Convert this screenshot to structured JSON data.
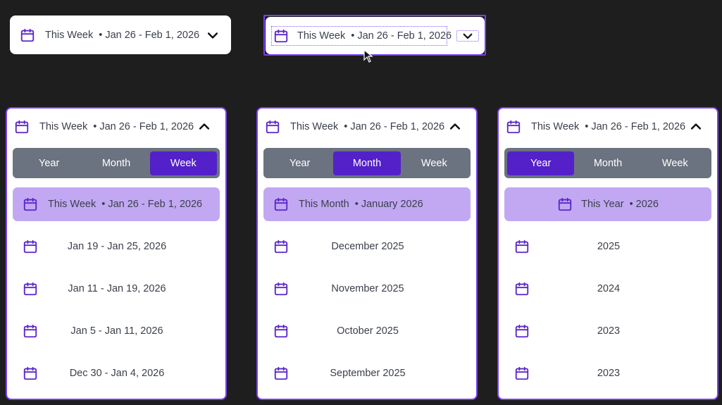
{
  "colors": {
    "accent": "#5420c9",
    "highlight": "#c2a8f3",
    "focus_border": "#7a3ff0",
    "segment_bg": "#6b7380"
  },
  "icons": {
    "calendar": "calendar-icon",
    "chevron_down": "chevron-down-icon",
    "chevron_up": "chevron-up-icon",
    "cursor": "mouse-pointer-icon"
  },
  "closed_picker": {
    "label": "This Week",
    "separator": "•",
    "range": "Jan 26 - Feb 1, 2026"
  },
  "focused_picker": {
    "label": "This Week",
    "separator": "•",
    "range": "Jan 26 - Feb 1, 2026"
  },
  "week_panel": {
    "header": {
      "label": "This Week",
      "separator": "•",
      "range": "Jan 26 - Feb 1, 2026"
    },
    "tabs": [
      "Year",
      "Month",
      "Week"
    ],
    "active_tab": "Week",
    "current": {
      "label": "This Week",
      "separator": "•",
      "range": "Jan 26 - Feb 1, 2026"
    },
    "options": [
      "Jan 19 - Jan 25, 2026",
      "Jan 11 - Jan 19, 2026",
      "Jan 5 - Jan 11, 2026",
      "Dec 30 - Jan 4, 2026"
    ]
  },
  "month_panel": {
    "header": {
      "label": "This Week",
      "separator": "•",
      "range": "Jan 26 - Feb 1, 2026"
    },
    "tabs": [
      "Year",
      "Month",
      "Week"
    ],
    "active_tab": "Month",
    "current": {
      "label": "This Month",
      "separator": "•",
      "range": "January 2026"
    },
    "options": [
      "December 2025",
      "November 2025",
      "October 2025",
      "September 2025"
    ]
  },
  "year_panel": {
    "header": {
      "label": "This Week",
      "separator": "•",
      "range": "Jan 26 - Feb 1, 2026"
    },
    "tabs": [
      "Year",
      "Month",
      "Week"
    ],
    "active_tab": "Year",
    "current": {
      "label": "This Year",
      "separator": "•",
      "range": "2026"
    },
    "options": [
      "2025",
      "2024",
      "2023",
      "2023"
    ]
  }
}
